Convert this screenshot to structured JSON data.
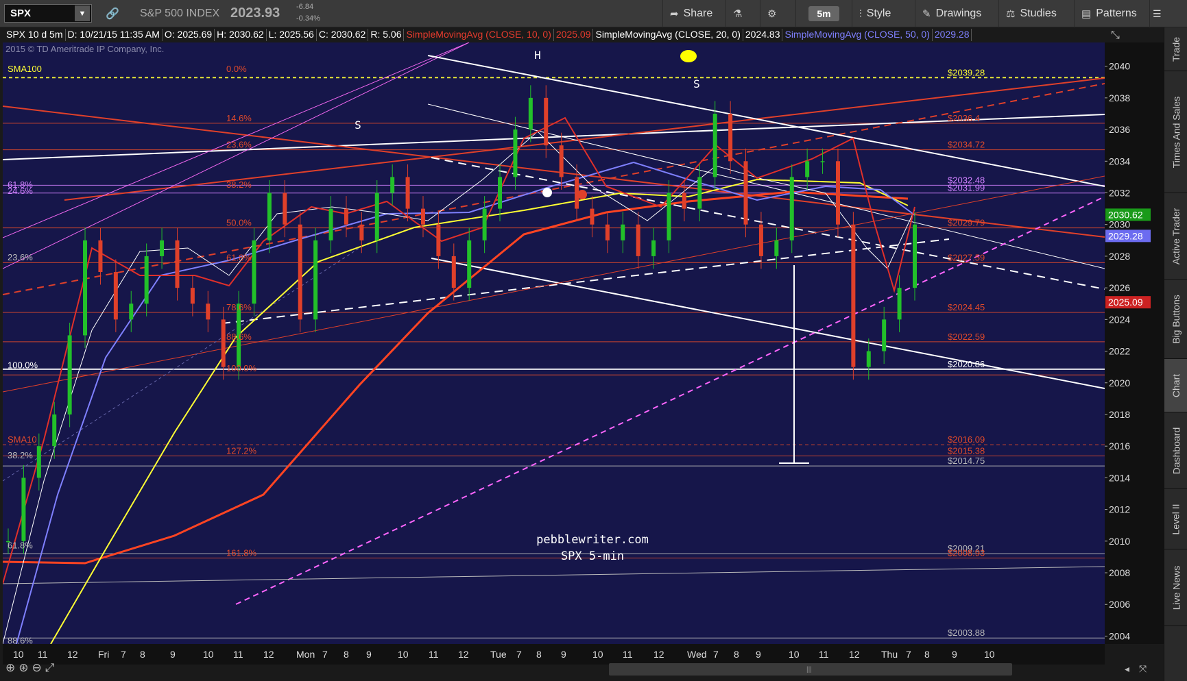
{
  "toolbar": {
    "symbol": "SPX",
    "index_name": "S&P 500 INDEX",
    "last_price": "2023.93",
    "change_abs": "-6.84",
    "change_pct": "-0.34%",
    "share_label": "Share",
    "period_label": "5m",
    "style_label": "Style",
    "drawings_label": "Drawings",
    "studies_label": "Studies",
    "patterns_label": "Patterns"
  },
  "infobar": {
    "symbol_period": "SPX 10 d 5m",
    "datetime": "D: 10/21/15 11:35 AM",
    "open": "O: 2025.69",
    "high": "H: 2030.62",
    "low": "L: 2025.56",
    "close": "C: 2030.62",
    "range": "R: 5.06",
    "sma10_label": "SimpleMovingAvg (CLOSE, 10, 0)",
    "sma10_value": "2025.09",
    "sma20_label": "SimpleMovingAvg (CLOSE, 20, 0)",
    "sma20_value": "2024.83",
    "sma50_label": "SimpleMovingAvg (CLOSE, 50, 0)",
    "sma50_value": "2029.28"
  },
  "chart_labels": {
    "copyright": "2015 © TD Ameritrade IP Company, Inc.",
    "watermark_line1": "pebblewriter.com",
    "watermark_line2": "SPX 5-min",
    "left_shoulder_1": "S",
    "head": "H",
    "right_shoulder": "S",
    "sma100_tag": "SMA100",
    "sma10_tag": "SMA10"
  },
  "fib_left": [
    "61.8%",
    "24.6%",
    "23.6%",
    "100.0%",
    "38.2%",
    "61.8%",
    "88.6%"
  ],
  "fib_center": [
    "0.0%",
    "14.6%",
    "23.6%",
    "38.2%",
    "50.0%",
    "61.8%",
    "78.6%",
    "88.6%",
    "100.0%",
    "127.2%",
    "161.8%"
  ],
  "right_levels": [
    "$2039.28",
    "$2036.4",
    "$2034.72",
    "$2032.48",
    "$2031.99",
    "$2029.79",
    "$2027.59",
    "$2024.45",
    "$2022.59",
    "$2020.86",
    "$2016.09",
    "$2015.38",
    "$2014.75",
    "$2009.21",
    "$2008.93",
    "$2003.88"
  ],
  "price_axis": {
    "ticks": [
      "2040",
      "2038",
      "2036",
      "2034",
      "2032",
      "2030",
      "2028",
      "2026",
      "2024",
      "2022",
      "2020",
      "2018",
      "2016",
      "2014",
      "2012",
      "2010",
      "2008",
      "2006",
      "2004"
    ],
    "tag_close": "2030.62",
    "tag_sma50": "2029.28",
    "tag_sma10": "2025.09"
  },
  "time_axis": {
    "ticks": [
      "10",
      "11",
      "12",
      "Fri",
      "7",
      "8",
      "9",
      "10",
      "11",
      "12",
      "Mon",
      "7",
      "8",
      "9",
      "10",
      "11",
      "12",
      "Tue",
      "7",
      "8",
      "9",
      "10",
      "11",
      "12",
      "Wed",
      "7",
      "8",
      "9",
      "10",
      "11",
      "12",
      "Thu",
      "7",
      "8",
      "9",
      "10"
    ]
  },
  "side_tabs": [
    "Trade",
    "Times And Sales",
    "Active Trader",
    "Big Buttons",
    "Chart",
    "Dashboard",
    "Level II",
    "Live News"
  ],
  "colors": {
    "background": "#16164a",
    "candle_up": "#22c02a",
    "candle_down": "#e0402a",
    "sma10": "#e0302a",
    "sma20": "#ffffff",
    "sma50": "#7f80ff",
    "sma100": "#ffff33",
    "sma200": "#ff4422"
  },
  "chart_data": {
    "type": "candlestick",
    "y_range": [
      2003.5,
      2041.5
    ],
    "ohlc_close_path": [
      2010,
      2014,
      2016,
      2018,
      2023,
      2029,
      2027,
      2024,
      2025,
      2028,
      2029,
      2026,
      2025,
      2024,
      2021,
      2025,
      2029,
      2032,
      2030,
      2024,
      2029,
      2031,
      2030,
      2029,
      2032,
      2033,
      2031,
      2030,
      2028,
      2026,
      2029,
      2031,
      2033,
      2036,
      2038,
      2035,
      2033,
      2031,
      2030,
      2029,
      2030,
      2028,
      2029,
      2032,
      2031,
      2033,
      2037,
      2034,
      2030,
      2028,
      2029,
      2033,
      2034,
      2034,
      2030,
      2021,
      2022,
      2024,
      2026,
      2030
    ],
    "series": [
      {
        "name": "SimpleMovingAvg (CLOSE, 10, 0)",
        "last": 2025.09
      },
      {
        "name": "SimpleMovingAvg (CLOSE, 20, 0)",
        "last": 2024.83
      },
      {
        "name": "SimpleMovingAvg (CLOSE, 50, 0)",
        "last": 2029.28
      }
    ]
  }
}
